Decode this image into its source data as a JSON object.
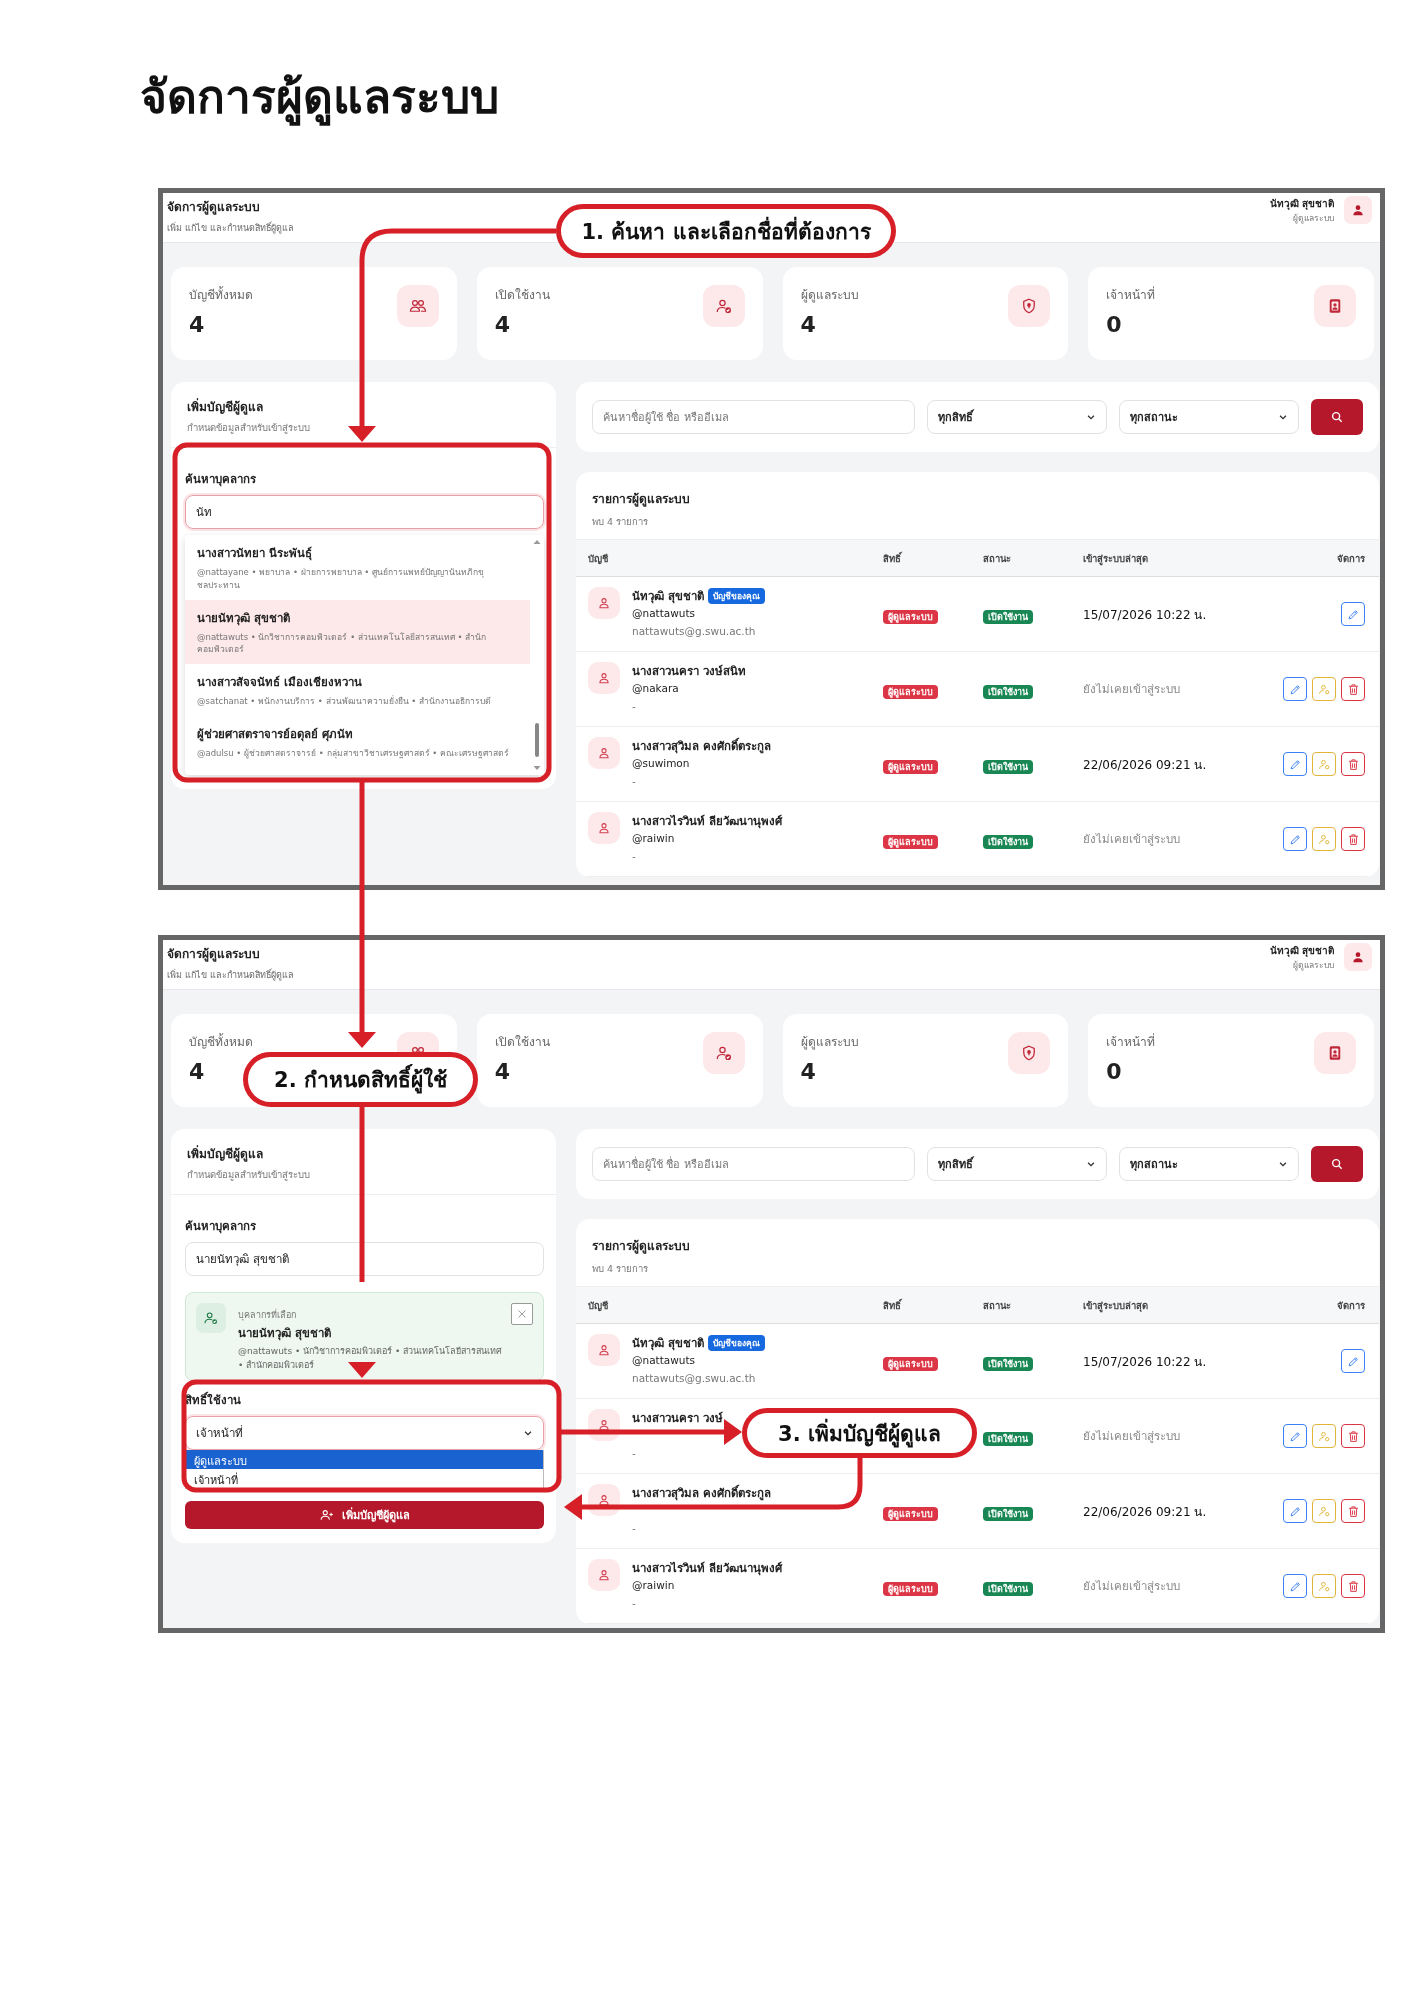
{
  "page_title": "จัดการผู้ดูแลระบบ",
  "screens": [
    {
      "header": {
        "title": "จัดการผู้ดูแลระบบ",
        "subtitle": "เพิ่ม แก้ไข และกำหนดสิทธิ์ผู้ดูแล",
        "user_name": "นัทวุฒิ สุขชาติ",
        "user_role": "ผู้ดูแลระบบ"
      },
      "stats": [
        {
          "kind": "accounts",
          "label": "บัญชีทั้งหมด",
          "value": "4"
        },
        {
          "kind": "active",
          "label": "เปิดใช้งาน",
          "value": "4"
        },
        {
          "kind": "admin",
          "label": "ผู้ดูแลระบบ",
          "value": "4"
        },
        {
          "kind": "staff",
          "label": "เจ้าหน้าที่",
          "value": "0"
        }
      ],
      "add_panel": {
        "title": "เพิ่มบัญชีผู้ดูแล",
        "subtitle": "กำหนดข้อมูลสำหรับเข้าสู่ระบบ",
        "search_label": "ค้นหาบุคลากร",
        "search_value": "นัท",
        "search_focused": true,
        "results": [
          {
            "name": "นางสาวนัทยา นีระพันธุ์",
            "detail": "@nattayane • พยาบาล • ฝ่ายการพยาบาล • ศูนย์การแพทย์ปัญญานันทภิกขุ ชลประทาน",
            "selected": false
          },
          {
            "name": "นายนัทวุฒิ สุขชาติ",
            "detail": "@nattawuts • นักวิชาการคอมพิวเตอร์ • ส่วนเทคโนโลยีสารสนเทศ • สำนักคอมพิวเตอร์",
            "selected": true
          },
          {
            "name": "นางสาวสัจจนัทธ์ เมืองเชียงหวาน",
            "detail": "@satchanat • พนักงานบริการ • ส่วนพัฒนาความยั่งยืน • สำนักงานอธิการบดี",
            "selected": false
          },
          {
            "name": "ผู้ช่วยศาสตราจารย์อดุลย์ ศุภนัท",
            "detail": "@adulsu • ผู้ช่วยศาสตราจารย์ • กลุ่มสาขาวิชาเศรษฐศาสตร์ • คณะเศรษฐศาสตร์",
            "selected": false
          }
        ]
      },
      "filters": {
        "placeholder": "ค้นหาชื่อผู้ใช้ ชื่อ หรืออีเมล",
        "role_filter": "ทุกสิทธิ์",
        "status_filter": "ทุกสถานะ"
      },
      "list": {
        "title": "รายการผู้ดูแลระบบ",
        "count": "พบ 4 รายการ",
        "columns": [
          "บัญชี",
          "สิทธิ์",
          "สถานะ",
          "เข้าสู่ระบบล่าสุด",
          "จัดการ"
        ],
        "rows": [
          {
            "name": "นัทวุฒิ สุขชาติ",
            "badge": "บัญชีของคุณ",
            "handle": "@nattawuts",
            "email": "nattawuts@g.swu.ac.th",
            "role": "ผู้ดูแลระบบ",
            "status": "เปิดใช้งาน",
            "last_login": "15/07/2026 10:22 น.",
            "logged_in": true,
            "actions": [
              {
                "kind": "edit"
              }
            ]
          },
          {
            "name": "นางสาวนครา วงษ์สนิท",
            "handle": "@nakara",
            "email": "-",
            "role": "ผู้ดูแลระบบ",
            "status": "เปิดใช้งาน",
            "last_login": "ยังไม่เคยเข้าสู่ระบบ",
            "logged_in": false,
            "actions": [
              {
                "kind": "edit"
              },
              {
                "kind": "role"
              },
              {
                "kind": "delete"
              }
            ]
          },
          {
            "name": "นางสาวสุวิมล คงศักดิ์ตระกูล",
            "handle": "@suwimon",
            "email": "-",
            "role": "ผู้ดูแลระบบ",
            "status": "เปิดใช้งาน",
            "last_login": "22/06/2026 09:21 น.",
            "logged_in": true,
            "actions": [
              {
                "kind": "edit"
              },
              {
                "kind": "role"
              },
              {
                "kind": "delete"
              }
            ]
          },
          {
            "name": "นางสาวไรวินท์ ลียวัฒนานุพงศ์",
            "handle": "@raiwin",
            "email": "-",
            "role": "ผู้ดูแลระบบ",
            "status": "เปิดใช้งาน",
            "last_login": "ยังไม่เคยเข้าสู่ระบบ",
            "logged_in": false,
            "actions": [
              {
                "kind": "edit"
              },
              {
                "kind": "role"
              },
              {
                "kind": "delete"
              }
            ]
          }
        ]
      }
    },
    {
      "header": {
        "title": "จัดการผู้ดูแลระบบ",
        "subtitle": "เพิ่ม แก้ไข และกำหนดสิทธิ์ผู้ดูแล",
        "user_name": "นัทวุฒิ สุขชาติ",
        "user_role": "ผู้ดูแลระบบ"
      },
      "stats": [
        {
          "kind": "accounts",
          "label": "บัญชีทั้งหมด",
          "value": "4"
        },
        {
          "kind": "active",
          "label": "เปิดใช้งาน",
          "value": "4"
        },
        {
          "kind": "admin",
          "label": "ผู้ดูแลระบบ",
          "value": "4"
        },
        {
          "kind": "staff",
          "label": "เจ้าหน้าที่",
          "value": "0"
        }
      ],
      "add_panel": {
        "title": "เพิ่มบัญชีผู้ดูแล",
        "subtitle": "กำหนดข้อมูลสำหรับเข้าสู่ระบบ",
        "search_label": "ค้นหาบุคลากร",
        "search_value": "นายนัทวุฒิ สุขชาติ",
        "search_focused": false,
        "selected_person": {
          "label": "บุคลากรที่เลือก",
          "name": "นายนัทวุฒิ สุขชาติ",
          "detail": "@nattawuts • นักวิชาการคอมพิวเตอร์ • ส่วนเทคโนโลยีสารสนเทศ • สำนักคอมพิวเตอร์"
        },
        "role_label": "สิทธิ์ใช้งาน",
        "role_value": "เจ้าหน้าที่",
        "role_focused": true,
        "role_options": [
          {
            "label": "ผู้ดูแลระบบ",
            "selected": true
          },
          {
            "label": "เจ้าหน้าที่",
            "selected": false
          }
        ],
        "submit_label": "เพิ่มบัญชีผู้ดูแล"
      },
      "filters": {
        "placeholder": "ค้นหาชื่อผู้ใช้ ชื่อ หรืออีเมล",
        "role_filter": "ทุกสิทธิ์",
        "status_filter": "ทุกสถานะ"
      },
      "list": {
        "title": "รายการผู้ดูแลระบบ",
        "count": "พบ 4 รายการ",
        "columns": [
          "บัญชี",
          "สิทธิ์",
          "สถานะ",
          "เข้าสู่ระบบล่าสุด",
          "จัดการ"
        ],
        "rows": [
          {
            "name": "นัทวุฒิ สุขชาติ",
            "badge": "บัญชีของคุณ",
            "handle": "@nattawuts",
            "email": "nattawuts@g.swu.ac.th",
            "role": "ผู้ดูแลระบบ",
            "status": "เปิดใช้งาน",
            "last_login": "15/07/2026 10:22 น.",
            "logged_in": true,
            "actions": [
              {
                "kind": "edit"
              }
            ]
          },
          {
            "name": "นางสาวนครา วงษ์",
            "email": "-",
            "status": "เปิดใช้งาน",
            "last_login": "ยังไม่เคยเข้าสู่ระบบ",
            "logged_in": false,
            "actions": [
              {
                "kind": "edit"
              },
              {
                "kind": "role"
              },
              {
                "kind": "delete"
              }
            ]
          },
          {
            "name": "นางสาวสุวิมล คงศักดิ์ตระกูล",
            "email": "-",
            "role": "ผู้ดูแลระบบ",
            "status": "เปิดใช้งาน",
            "last_login": "22/06/2026 09:21 น.",
            "logged_in": true,
            "actions": [
              {
                "kind": "edit"
              },
              {
                "kind": "role"
              },
              {
                "kind": "delete"
              }
            ]
          },
          {
            "name": "นางสาวไรวินท์ ลียวัฒนานุพงศ์",
            "handle": "@raiwin",
            "email": "-",
            "role": "ผู้ดูแลระบบ",
            "status": "เปิดใช้งาน",
            "last_login": "ยังไม่เคยเข้าสู่ระบบ",
            "logged_in": false,
            "actions": [
              {
                "kind": "edit"
              },
              {
                "kind": "role"
              },
              {
                "kind": "delete"
              }
            ]
          }
        ]
      }
    }
  ],
  "annotations": [
    {
      "text": "1. ค้นหา และเลือกชื่อที่ต้องการ"
    },
    {
      "text": "2. กำหนดสิทธิ์ผู้ใช้"
    },
    {
      "text": "3. เพิ่มบัญชีผู้ดูแล"
    }
  ]
}
